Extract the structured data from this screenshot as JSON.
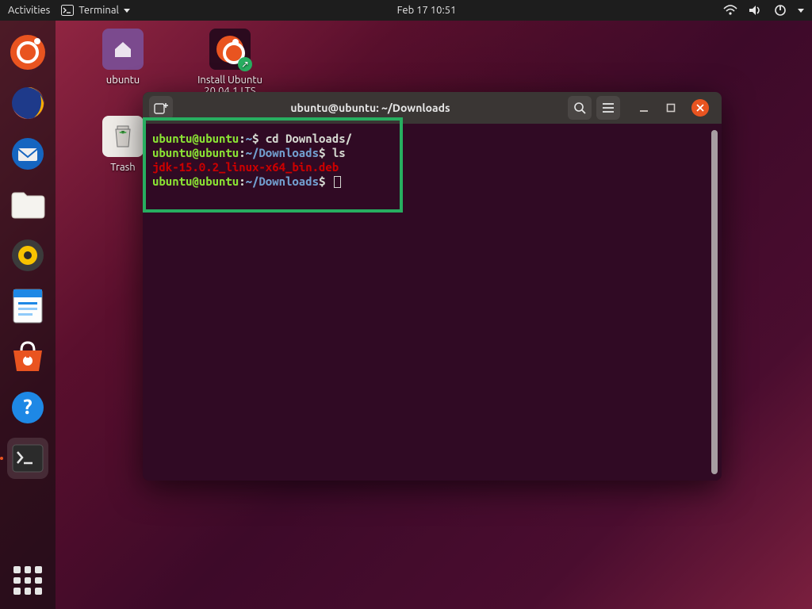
{
  "topbar": {
    "activities": "Activities",
    "app_menu": "Terminal",
    "datetime": "Feb 17  10:51"
  },
  "desktop_icons": {
    "home": "ubuntu",
    "installer": "Install Ubuntu 20.04.1 LTS",
    "trash": "Trash"
  },
  "dock": {
    "items": [
      "ubuntu-logo",
      "firefox",
      "thunderbird",
      "files",
      "rhythmbox",
      "writer",
      "software",
      "help",
      "terminal"
    ]
  },
  "terminal": {
    "title": "ubuntu@ubuntu: ~/Downloads",
    "lines": [
      {
        "user": "ubuntu",
        "host": "ubuntu",
        "path": "~",
        "cmd": "cd Downloads/"
      },
      {
        "user": "ubuntu",
        "host": "ubuntu",
        "path": "~/Downloads",
        "cmd": "ls"
      },
      {
        "file": "jdk-15.0.2_linux-x64_bin.deb"
      },
      {
        "user": "ubuntu",
        "host": "ubuntu",
        "path": "~/Downloads",
        "cmd": "",
        "cursor": true
      }
    ]
  }
}
